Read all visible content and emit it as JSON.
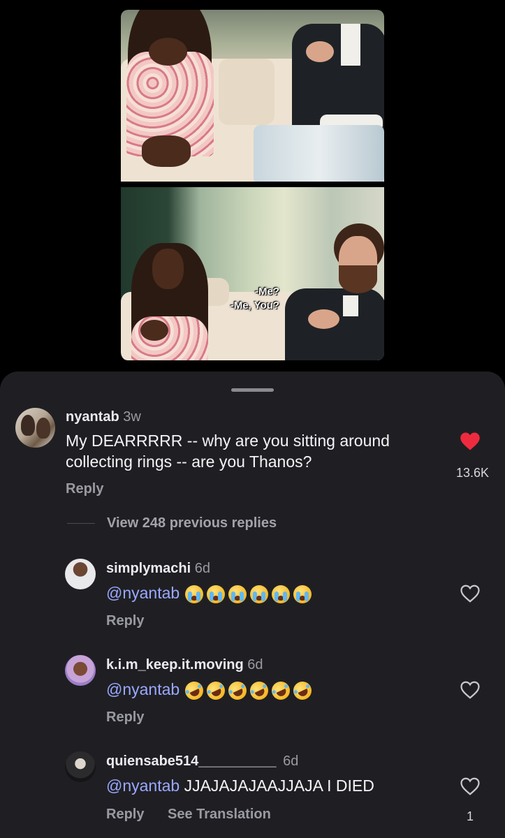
{
  "video": {
    "subtitle_line1": "-Me?",
    "subtitle_line2": "-Me, You?"
  },
  "comment": {
    "username": "nyantab",
    "time": "3w",
    "text": "My DEARRRRR -- why are you sitting around collecting rings -- are you Thanos?",
    "reply_label": "Reply",
    "likes": "13.6K",
    "liked": true,
    "heart_color": "#ee2b3e"
  },
  "view_replies": "View 248 previous replies",
  "replies": [
    {
      "username": "simplymachi",
      "time": "6d",
      "mention": "@nyantab",
      "emoji": [
        "loudly-crying-face",
        "loudly-crying-face",
        "loudly-crying-face",
        "loudly-crying-face",
        "loudly-crying-face",
        "loudly-crying-face"
      ],
      "reply_label": "Reply"
    },
    {
      "username": "k.i.m_keep.it.moving",
      "time": "6d",
      "mention": "@nyantab",
      "emoji": [
        "rolling-on-floor-laughing",
        "rolling-on-floor-laughing",
        "rolling-on-floor-laughing",
        "rolling-on-floor-laughing",
        "rolling-on-floor-laughing",
        "rolling-on-floor-laughing"
      ],
      "reply_label": "Reply"
    },
    {
      "username": "quiensabe514__________",
      "time": "6d",
      "mention": "@nyantab",
      "text": "JJAJAJAJAAJJAJA I DIED",
      "reply_label": "Reply",
      "see_translation": "See Translation",
      "likes": "1"
    }
  ],
  "colors": {
    "sheet_bg": "#1f1f23",
    "mention": "#9aa8ff",
    "muted": "#9a9aa2"
  }
}
